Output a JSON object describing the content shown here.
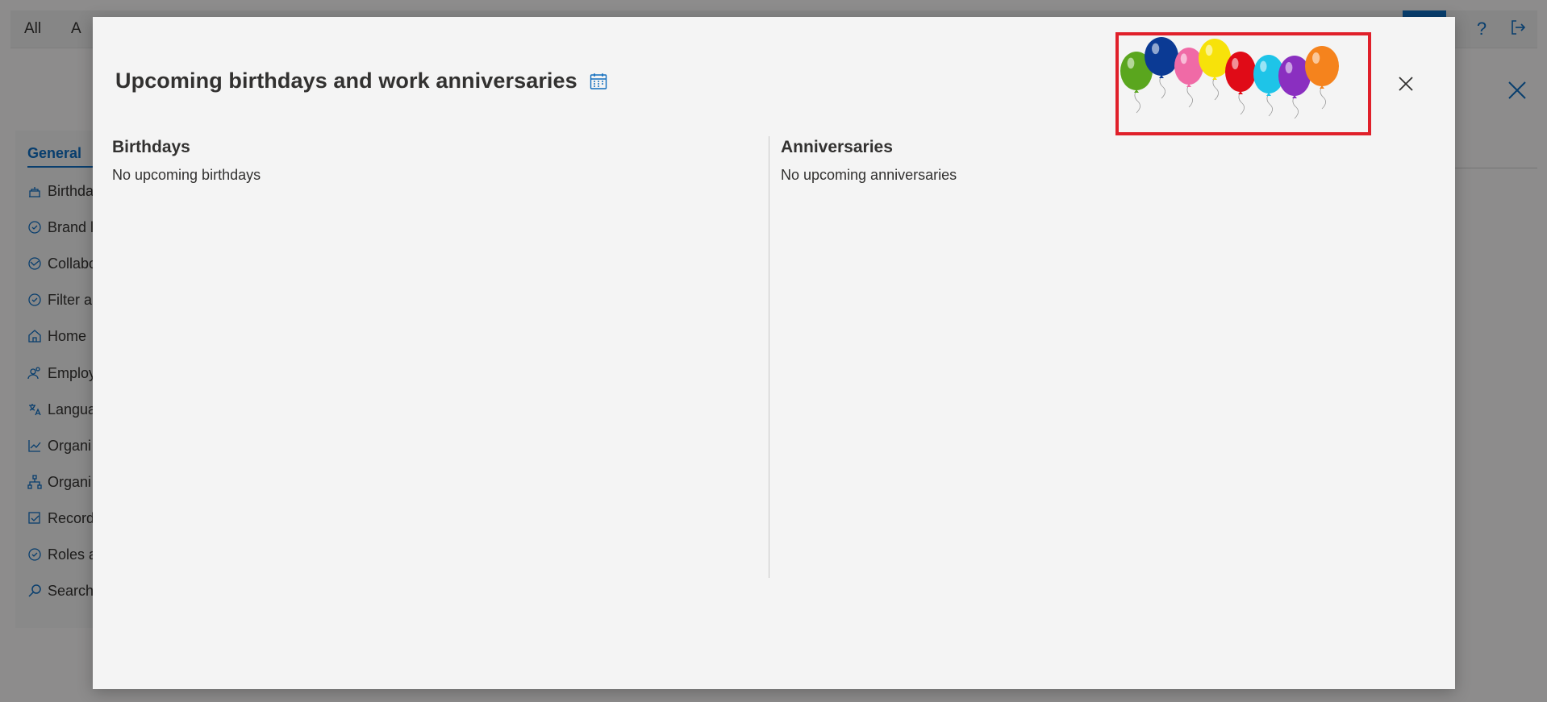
{
  "background": {
    "topbar": {
      "tabs": [
        "All",
        "A"
      ]
    },
    "side_panel": {
      "general_tab": "General",
      "items": [
        {
          "label": "Birthda",
          "icon": "cake-icon"
        },
        {
          "label": "Brand l",
          "icon": "badge-icon"
        },
        {
          "label": "Collabo",
          "icon": "handshake-icon"
        },
        {
          "label": "Filter a",
          "icon": "badge-icon"
        },
        {
          "label": "Home",
          "icon": "home-icon"
        },
        {
          "label": "Employ",
          "icon": "people-icon"
        },
        {
          "label": "Langua",
          "icon": "translate-icon"
        },
        {
          "label": "Organi",
          "icon": "chart-icon"
        },
        {
          "label": "Organi",
          "icon": "org-chart-icon"
        },
        {
          "label": "Record",
          "icon": "checklist-icon"
        },
        {
          "label": "Roles a",
          "icon": "badge-icon"
        },
        {
          "label": "Search",
          "icon": "search-icon"
        }
      ]
    }
  },
  "dialog": {
    "title": "Upcoming birthdays and work anniversaries",
    "birthdays": {
      "heading": "Birthdays",
      "empty_text": "No upcoming birthdays"
    },
    "anniversaries": {
      "heading": "Anniversaries",
      "empty_text": "No upcoming anniversaries"
    },
    "balloon_colors": [
      "#5aa61e",
      "#0b3a94",
      "#f06aa6",
      "#f7e20a",
      "#e00b17",
      "#1ec4e8",
      "#8a2fc0",
      "#f5831d"
    ]
  },
  "colors": {
    "accent": "#0f6cbd",
    "highlight_frame": "#e0202a"
  }
}
